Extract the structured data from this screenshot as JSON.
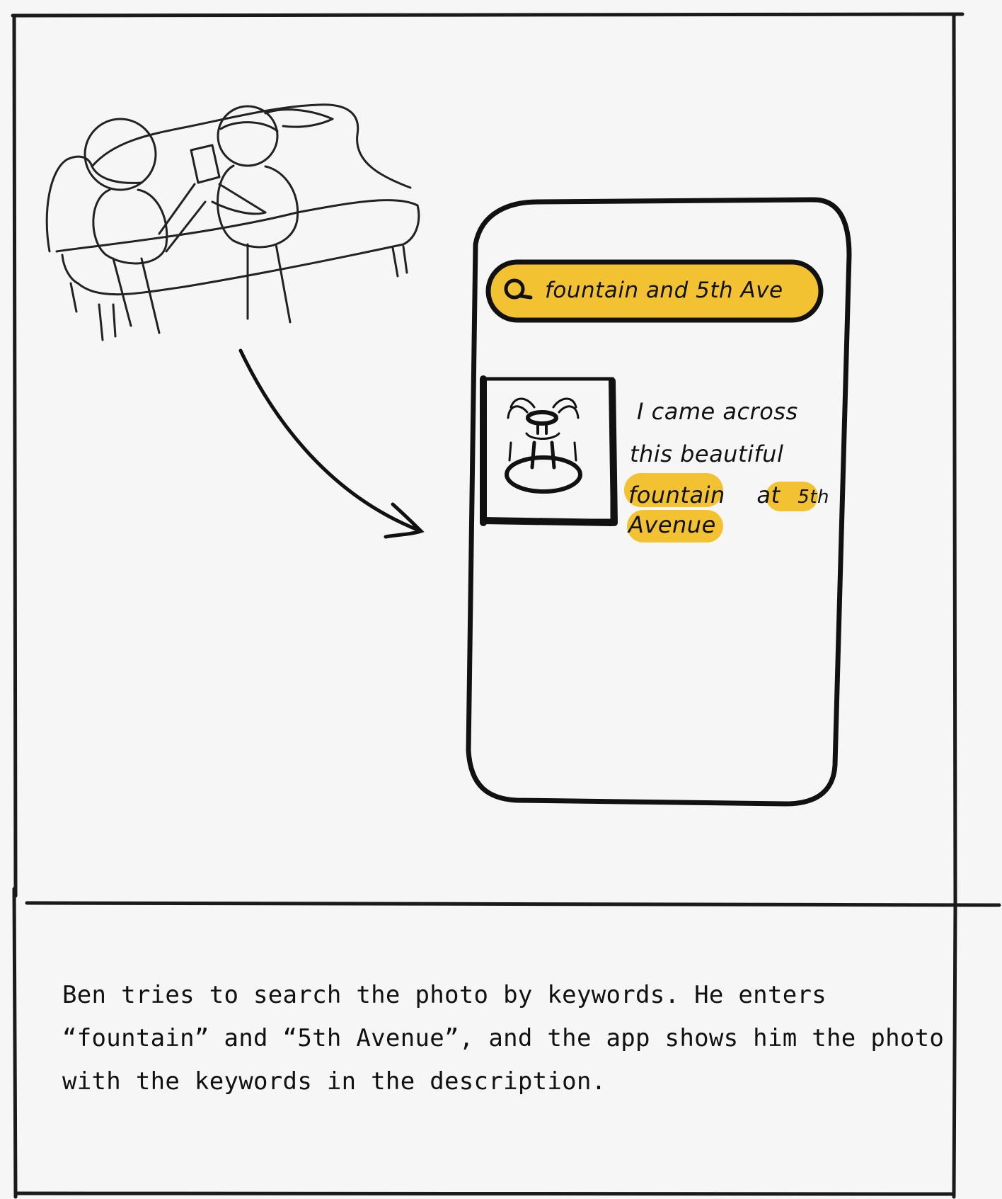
{
  "search": {
    "query": "fountain and 5th Ave"
  },
  "post": {
    "line1": "I came across",
    "line2": "this beautiful",
    "line3_hl1": "fountain",
    "line3_mid": "at",
    "line3_hl2": "5th",
    "line4_hl": "Avenue"
  },
  "caption": {
    "text": "Ben tries to search the photo by keywords. He enters “fountain” and “5th Avenue”, and the app shows him the photo with the keywords in the description."
  },
  "colors": {
    "highlight": "#f3c232",
    "ink": "#111111",
    "paper": "#f6f6f6"
  }
}
